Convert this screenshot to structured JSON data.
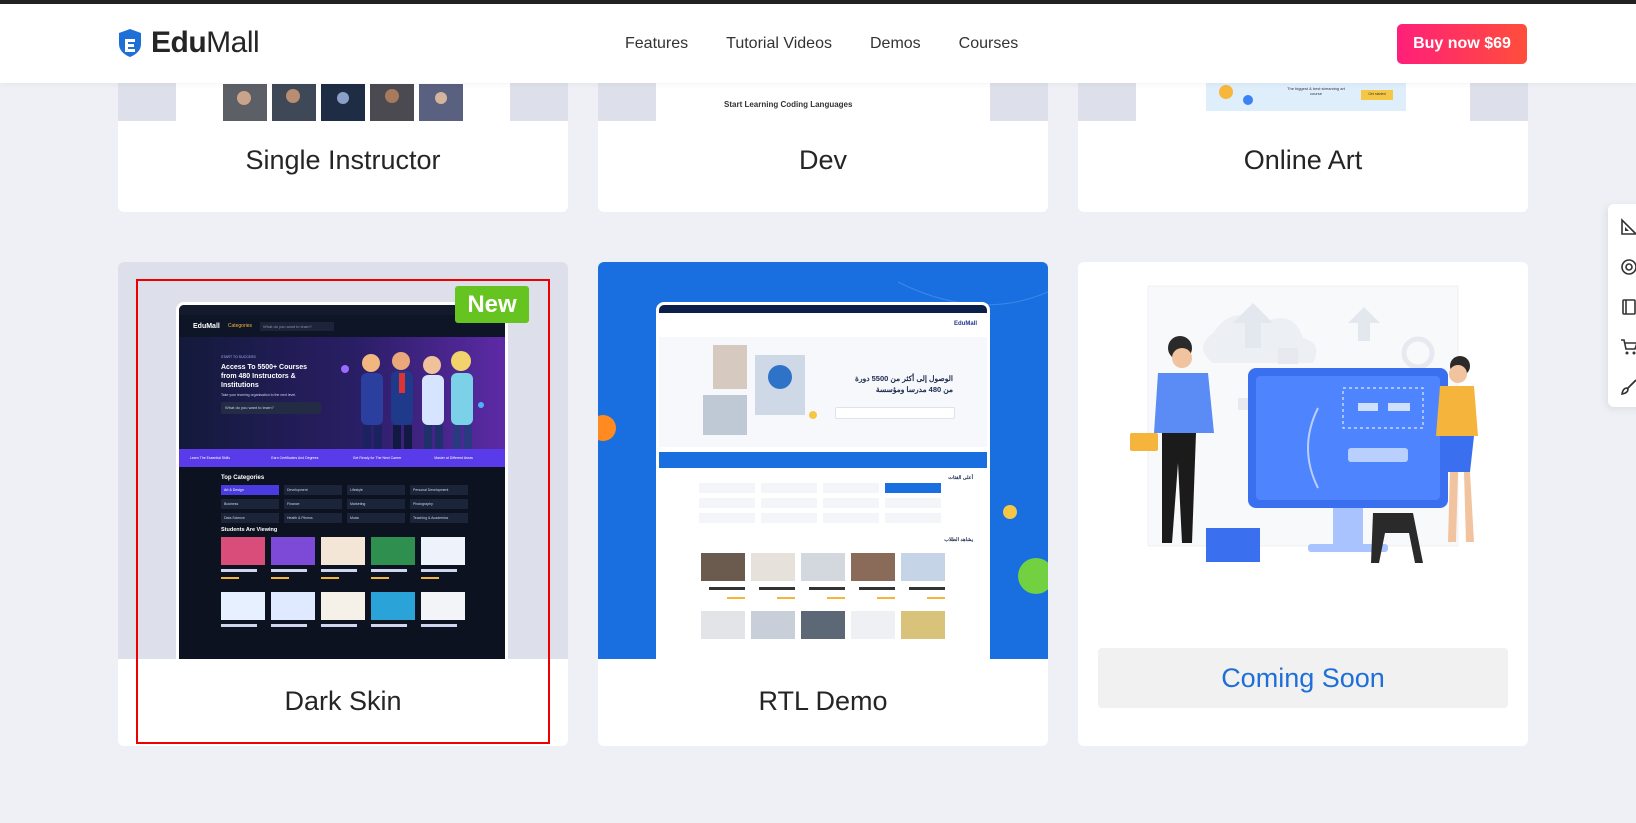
{
  "header": {
    "logo_main": "Edu",
    "logo_light": "Mall",
    "nav": [
      "Features",
      "Tutorial Videos",
      "Demos",
      "Courses"
    ],
    "buy_label": "Buy now $69"
  },
  "demos_row1": [
    {
      "title": "Single Instructor"
    },
    {
      "title": "Dev",
      "caption": "Start Learning Coding Languages"
    },
    {
      "title": "Online Art",
      "ad_heading": "The biggest & best streaming art course",
      "ad_button": "Get started"
    }
  ],
  "demos_row2": [
    {
      "title": "Dark Skin",
      "badge": "New"
    },
    {
      "title": "RTL Demo"
    },
    {
      "title": "",
      "button": "Coming Soon"
    }
  ],
  "dark_skin_preview": {
    "logo": "EduMall",
    "categories_label": "Categories",
    "search_placeholder": "What do you want to learn?",
    "kicker": "START TO SUCCESS",
    "headline": "Access To 5500+ Courses from 480 Instructors & Institutions",
    "subline": "Take your learning organisation to the next level.",
    "hero_search": "What do you want to learn?",
    "features": [
      "Learn The Essential Skills",
      "Earn Certificates And Degrees",
      "Get Ready for The Next Career",
      "Master at Different Areas"
    ],
    "top_categories_title": "Top Categories",
    "categories": [
      "Art & Design",
      "Development",
      "Lifestyle",
      "Personal Development",
      "Business",
      "Finance",
      "Marketing",
      "Photography",
      "Data Science",
      "Health & Fitness",
      "Music",
      "Teaching & Academics"
    ],
    "students_title": "Students Are Viewing"
  },
  "rtl_preview": {
    "logo": "EduMall",
    "headline_line1": "الوصول إلى أكثر من 5500 دورة",
    "headline_line2": "من 480 مدرسا ومؤسسة",
    "section_categories": "أعلى الفئات",
    "section_students": "يشاهد الطلاب"
  },
  "colors": {
    "accent_blue": "#1f6fd8",
    "buy_gradient_start": "#ff1f7a",
    "buy_gradient_end": "#ff4e3b",
    "badge_green": "#65c41f",
    "highlight_red": "#ee0000",
    "page_bg": "#eef0f5"
  },
  "icons": [
    "pencil-ruler-icon",
    "lifebuoy-icon",
    "book-icon",
    "cart-icon",
    "brush-icon"
  ]
}
